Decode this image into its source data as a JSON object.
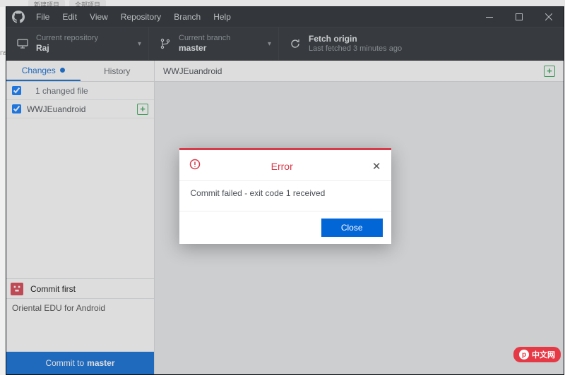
{
  "bg_tabs": [
    "新建项目",
    "全部项目"
  ],
  "menu": {
    "file": "File",
    "edit": "Edit",
    "view": "View",
    "repository": "Repository",
    "branch": "Branch",
    "help": "Help"
  },
  "toolbar": {
    "repo": {
      "sub": "Current repository",
      "main": "Raj"
    },
    "branch": {
      "sub": "Current branch",
      "main": "master"
    },
    "fetch": {
      "main": "Fetch origin",
      "sub": "Last fetched 3 minutes ago"
    }
  },
  "sidebar": {
    "tabs": {
      "changes": "Changes",
      "history": "History"
    },
    "summary": "1 changed file",
    "file": "WWJEuandroid"
  },
  "commit": {
    "summary_placeholder": "Commit first",
    "description": "Oriental EDU for Android",
    "button_prefix": "Commit to ",
    "button_branch": "master"
  },
  "content": {
    "crumb": "WWJEuandroid"
  },
  "modal": {
    "title": "Error",
    "message": "Commit failed - exit code 1 received",
    "close": "Close"
  },
  "watermark": "中文网",
  "left_slice": "ns"
}
